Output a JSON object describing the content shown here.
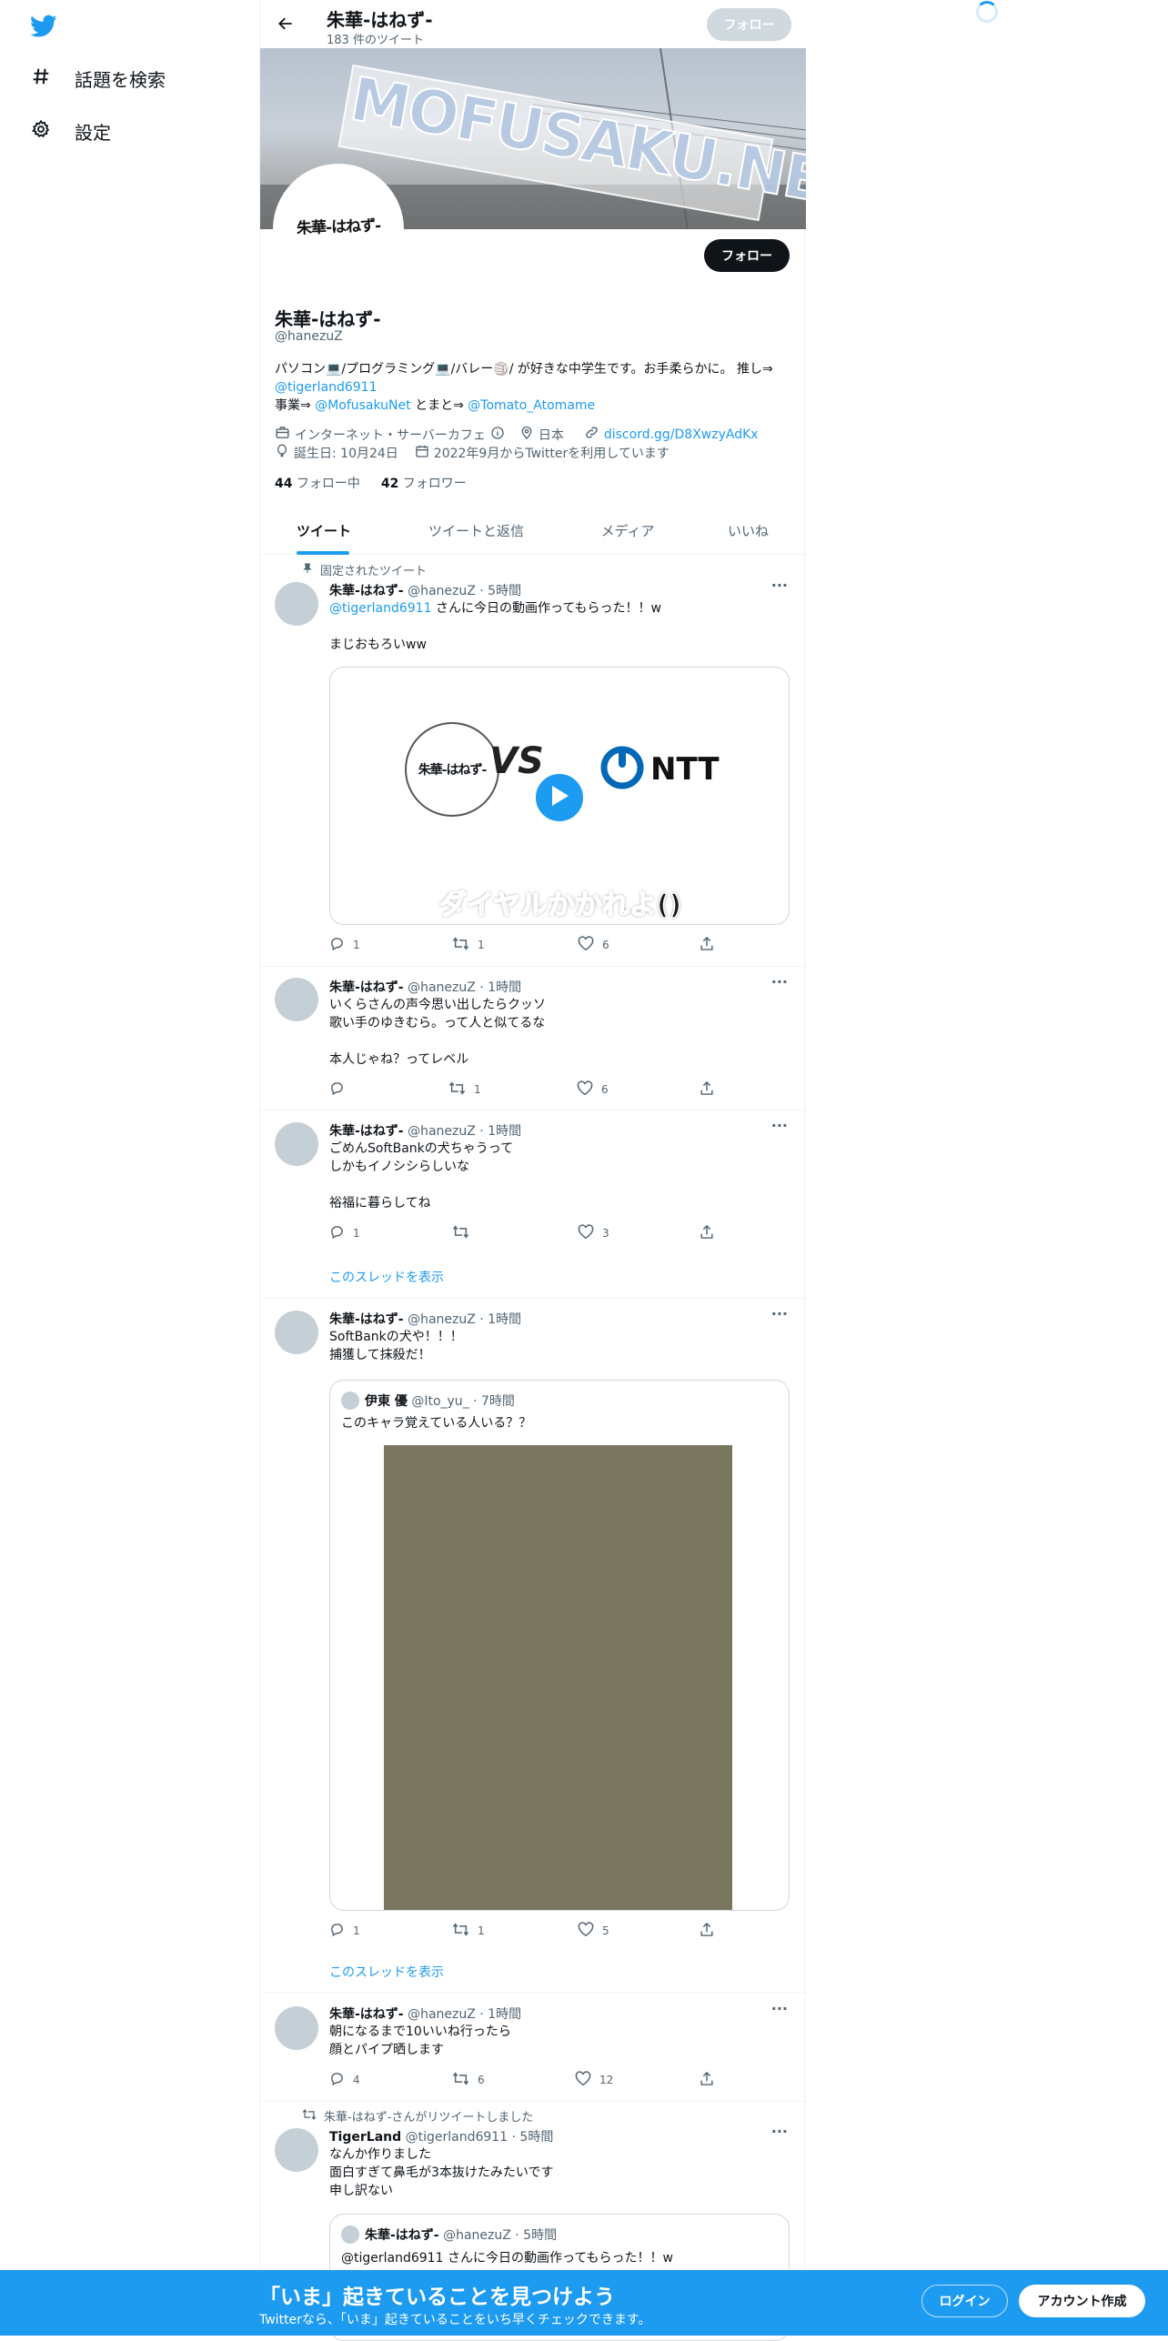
{
  "colors": {
    "accent": "#1d9bf0",
    "text": "#0f1419",
    "muted": "#536471",
    "border": "#eff3f4"
  },
  "sidebar": {
    "logo": "twitter-bird-icon",
    "items": [
      {
        "icon": "hashtag-icon",
        "label": "話題を検索"
      },
      {
        "icon": "gear-icon",
        "label": "設定"
      }
    ]
  },
  "header": {
    "name": "朱華-はねず-",
    "tweet_count": "183 件のツイート",
    "follow_label": "フォロー"
  },
  "banner": {
    "watermark": "MOFUSAKU.NET"
  },
  "profile": {
    "avatar_text": "朱華-はねず-",
    "follow_label": "フォロー",
    "name": "朱華-はねず-",
    "handle": "@hanezuZ",
    "bio_line1": "パソコン💻/プログラミング💻/バレー🏐/ が好きな中学生です。お手柔らかに。 推し⇒ ",
    "bio_mention1": "@tigerland6911",
    "bio_line2": "事業⇒ ",
    "bio_mention2": "@MofusakuNet",
    "bio_line3": " とまと⇒ ",
    "bio_mention3": "@Tomato_Atomame",
    "category": "インターネット・サーバーカフェ",
    "location": "日本",
    "website": "discord.gg/D8XwzyAdKx",
    "birthday": "誕生日: 10月24日",
    "joined": "2022年9月からTwitterを利用しています",
    "following_count": "44",
    "following_label": "フォロー中",
    "followers_count": "42",
    "followers_label": "フォロワー"
  },
  "tabs": [
    "ツイート",
    "ツイートと返信",
    "メディア",
    "いいね"
  ],
  "tweets": [
    {
      "pinned_label": "固定されたツイート",
      "name": "朱華-はねず-",
      "meta": "@hanezuZ · 5時間",
      "mention": "@tigerland6911",
      "text1": " さんに今日の動画作ってもらった！！w",
      "text2": "まじおもろいww",
      "media": {
        "left_badge": "朱華-はねず-",
        "vs": "VS",
        "right_brand": "NTT",
        "caption": "ダイヤルかかれよ()"
      },
      "reply": "1",
      "retweet": "1",
      "like": "6"
    },
    {
      "name": "朱華-はねず-",
      "meta": "@hanezuZ · 1時間",
      "lines": [
        "いくらさんの声今思い出したらクッソ",
        "歌い手のゆきむら。って人と似てるな",
        "",
        "本人じゃね？ってレベル"
      ],
      "reply": "",
      "retweet": "1",
      "like": "6"
    },
    {
      "name": "朱華-はねず-",
      "meta": "@hanezuZ · 1時間",
      "lines": [
        "ごめんSoftBankの犬ちゃうって",
        "しかもイノシシらしいな",
        "",
        "裕福に暮らしてね"
      ],
      "reply": "1",
      "retweet": "",
      "like": "3",
      "thread": "このスレッドを表示"
    },
    {
      "name": "朱華-はねず-",
      "meta": "@hanezuZ · 1時間",
      "lines": [
        "SoftBankの犬や！！！",
        "捕獲して抹殺だ！"
      ],
      "quote": {
        "name": "伊東 優",
        "meta": "@Ito_yu_ · 7時間",
        "text": "このキャラ覚えている人いる？？",
        "media_color": "#78765f"
      },
      "reply": "1",
      "retweet": "1",
      "like": "5",
      "thread": "このスレッドを表示"
    },
    {
      "name": "朱華-はねず-",
      "meta": "@hanezuZ · 1時間",
      "lines": [
        "朝になるまで10いいね行ったら",
        "顔とパイプ晒します"
      ],
      "reply": "4",
      "retweet": "6",
      "like": "12"
    },
    {
      "retweeted_label": "朱華-はねず-さんがリツイートしました",
      "name": "TigerLand",
      "meta": "@tigerland6911 · 5時間",
      "lines": [
        "なんか作りました",
        "面白すぎて鼻毛が3本抜けたみたいです",
        "申し訳ない"
      ],
      "quote": {
        "name": "朱華-はねず-",
        "meta": "@hanezuZ · 5時間",
        "text": "@tigerland6911 さんに今日の動画作ってもらった！！w"
      }
    }
  ],
  "bottom_bar": {
    "title": "「いま」起きていることを見つけよう",
    "subtitle": "Twitterなら、「いま」起きていることをいち早くチェックできます。",
    "login": "ログイン",
    "signup": "アカウント作成"
  }
}
